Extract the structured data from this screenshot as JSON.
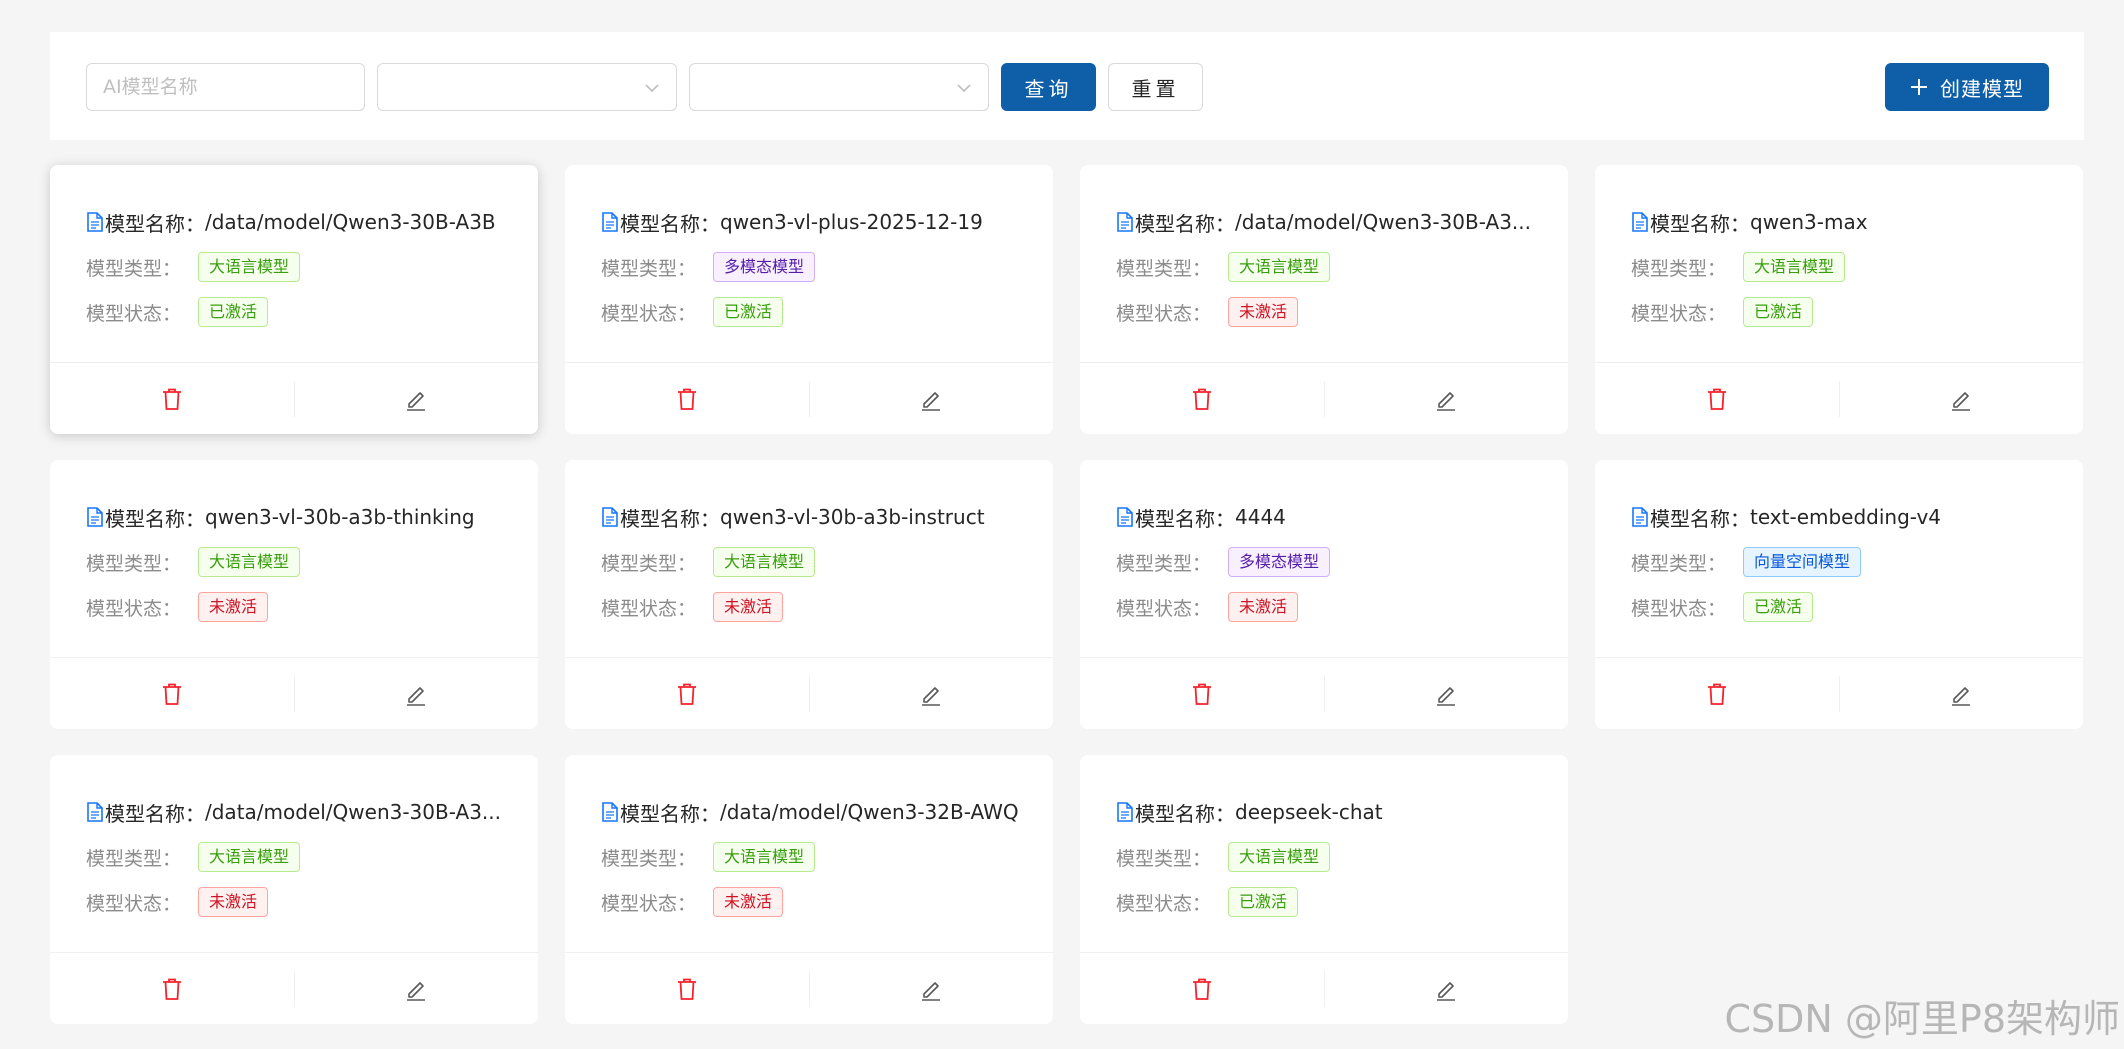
{
  "toolbar": {
    "search_placeholder": "AI模型名称",
    "type_select_value": "",
    "status_select_value": "",
    "query_label": "查询",
    "reset_label": "重置",
    "create_label": "创建模型"
  },
  "labels": {
    "name": "模型名称：",
    "type": "模型类型：",
    "status": "模型状态："
  },
  "colors": {
    "primary": "#0f5fa8",
    "delete": "#f5222d",
    "edit": "#595959"
  },
  "cards": [
    {
      "name": "/data/model/Qwen3-30B-A3B",
      "type": "大语言模型",
      "type_color": "green",
      "status": "已激活",
      "status_color": "green"
    },
    {
      "name": "qwen3-vl-plus-2025-12-19",
      "type": "多模态模型",
      "type_color": "purple",
      "status": "已激活",
      "status_color": "green"
    },
    {
      "name": "/data/model/Qwen3-30B-A3...",
      "type": "大语言模型",
      "type_color": "green",
      "status": "未激活",
      "status_color": "red"
    },
    {
      "name": "qwen3-max",
      "type": "大语言模型",
      "type_color": "green",
      "status": "已激活",
      "status_color": "green"
    },
    {
      "name": "qwen3-vl-30b-a3b-thinking",
      "type": "大语言模型",
      "type_color": "green",
      "status": "未激活",
      "status_color": "red"
    },
    {
      "name": "qwen3-vl-30b-a3b-instruct",
      "type": "大语言模型",
      "type_color": "green",
      "status": "未激活",
      "status_color": "red"
    },
    {
      "name": "4444",
      "type": "多模态模型",
      "type_color": "purple",
      "status": "未激活",
      "status_color": "red"
    },
    {
      "name": "text-embedding-v4",
      "type": "向量空间模型",
      "type_color": "blue",
      "status": "已激活",
      "status_color": "green"
    },
    {
      "name": "/data/model/Qwen3-30B-A3...",
      "type": "大语言模型",
      "type_color": "green",
      "status": "未激活",
      "status_color": "red"
    },
    {
      "name": "/data/model/Qwen3-32B-AWQ",
      "type": "大语言模型",
      "type_color": "green",
      "status": "未激活",
      "status_color": "red"
    },
    {
      "name": "deepseek-chat",
      "type": "大语言模型",
      "type_color": "green",
      "status": "已激活",
      "status_color": "green"
    }
  ],
  "watermark": "CSDN @阿里P8架构师"
}
